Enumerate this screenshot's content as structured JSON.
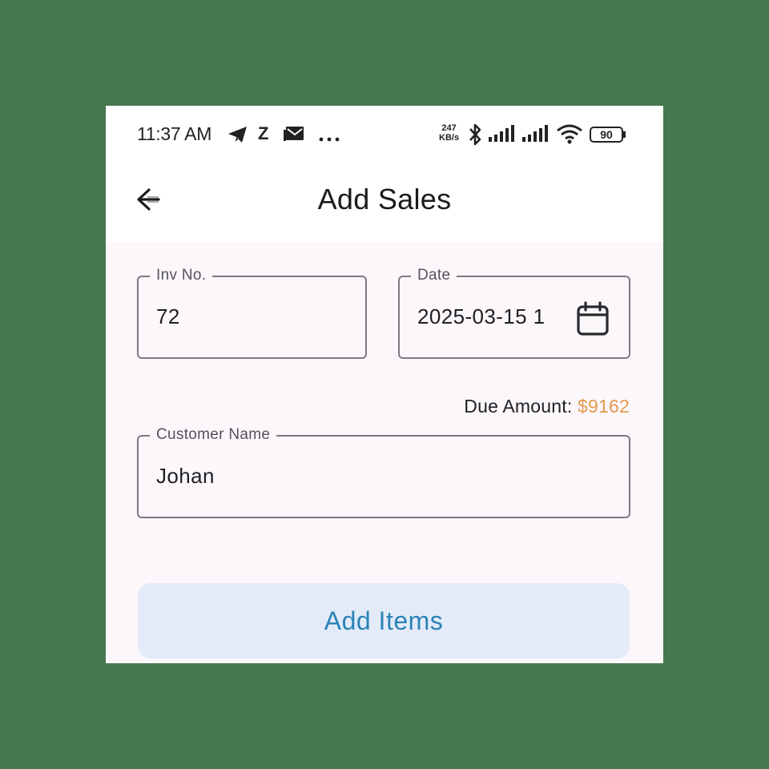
{
  "status_bar": {
    "time": "11:37 AM",
    "net_speed_value": "247",
    "net_speed_unit": "KB/s",
    "battery": "90",
    "icons": [
      "telegram-icon",
      "z-icon",
      "mail-icon",
      "more-dots-icon",
      "bluetooth-icon",
      "signal-icon",
      "signal-icon",
      "wifi-icon",
      "battery-icon"
    ]
  },
  "app_bar": {
    "title": "Add Sales",
    "back_icon": "arrow-left-icon"
  },
  "form": {
    "invoice": {
      "label": "Inv No.",
      "value": "72"
    },
    "date": {
      "label": "Date",
      "value": "2025-03-15 1",
      "icon": "calendar-icon"
    },
    "due": {
      "label": "Due Amount:",
      "amount": "$9162"
    },
    "customer": {
      "label": "Customer Name",
      "value": "Johan"
    }
  },
  "actions": {
    "add_items_label": "Add Items"
  },
  "colors": {
    "background": "#45774d",
    "screen": "#fbf7fb",
    "accent": "#2b83b6",
    "due_amount": "#e29a4c",
    "button_bg": "#e3ebf8"
  }
}
